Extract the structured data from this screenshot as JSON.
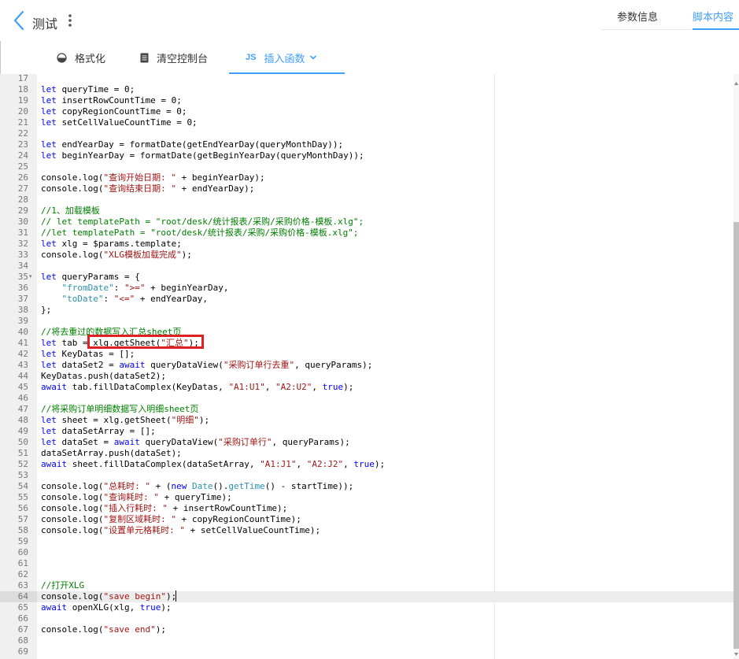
{
  "header": {
    "title": "测试",
    "right_tabs": [
      {
        "label": "参数信息"
      },
      {
        "label": "脚本内容"
      }
    ]
  },
  "toolbar": {
    "format_label": "格式化",
    "clear_console_label": "清空控制台",
    "js_badge": "JS",
    "insert_function_label": "插入函数"
  },
  "editor": {
    "active_line": 64,
    "lines": [
      {
        "n": 17,
        "code": ""
      },
      {
        "n": 18,
        "code": "let queryTime = 0;"
      },
      {
        "n": 19,
        "code": "let insertRowCountTime = 0;"
      },
      {
        "n": 20,
        "code": "let copyRegionCountTime = 0;"
      },
      {
        "n": 21,
        "code": "let setCellValueCountTime = 0;"
      },
      {
        "n": 22,
        "code": ""
      },
      {
        "n": 23,
        "code": "let endYearDay = formatDate(getEndYearDay(queryMonthDay));"
      },
      {
        "n": 24,
        "code": "let beginYearDay = formatDate(getBeginYearDay(queryMonthDay));"
      },
      {
        "n": 25,
        "code": ""
      },
      {
        "n": 26,
        "code": "console.log(\"查询开始日期: \" + beginYearDay);"
      },
      {
        "n": 27,
        "code": "console.log(\"查询结束日期: \" + endYearDay);"
      },
      {
        "n": 28,
        "code": ""
      },
      {
        "n": 29,
        "code": "//1、加载模板"
      },
      {
        "n": 30,
        "code": "// let templatePath = \"root/desk/统计报表/采购/采购价格-模板.xlg\";"
      },
      {
        "n": 31,
        "code": "//let templatePath = \"root/desk/统计报表/采购/采购价格-模板.xlg\";"
      },
      {
        "n": 32,
        "code": "let xlg = $params.template;"
      },
      {
        "n": 33,
        "code": "console.log(\"XLG模板加载完成\");"
      },
      {
        "n": 34,
        "code": ""
      },
      {
        "n": 35,
        "code": "let queryParams = {",
        "fold": true
      },
      {
        "n": 36,
        "code": "    \"fromDate\": \">=\" + beginYearDay,"
      },
      {
        "n": 37,
        "code": "    \"toDate\": \"<=\" + endYearDay,"
      },
      {
        "n": 38,
        "code": "};"
      },
      {
        "n": 39,
        "code": ""
      },
      {
        "n": 40,
        "code": "//将去重过的数据写入汇总sheet页"
      },
      {
        "n": 41,
        "code": "let tab = xlg.getSheet(\"汇总\");"
      },
      {
        "n": 42,
        "code": "let KeyDatas = [];"
      },
      {
        "n": 43,
        "code": "let dataSet2 = await queryDataView(\"采购订单行去重\", queryParams);"
      },
      {
        "n": 44,
        "code": "KeyDatas.push(dataSet2);"
      },
      {
        "n": 45,
        "code": "await tab.fillDataComplex(KeyDatas, \"A1:U1\", \"A2:U2\", true);"
      },
      {
        "n": 46,
        "code": ""
      },
      {
        "n": 47,
        "code": "//将采购订单明细数据写入明细sheet页"
      },
      {
        "n": 48,
        "code": "let sheet = xlg.getSheet(\"明细\");"
      },
      {
        "n": 49,
        "code": "let dataSetArray = [];"
      },
      {
        "n": 50,
        "code": "let dataSet = await queryDataView(\"采购订单行\", queryParams);"
      },
      {
        "n": 51,
        "code": "dataSetArray.push(dataSet);"
      },
      {
        "n": 52,
        "code": "await sheet.fillDataComplex(dataSetArray, \"A1:J1\", \"A2:J2\", true);"
      },
      {
        "n": 53,
        "code": ""
      },
      {
        "n": 54,
        "code": "console.log(\"总耗时: \" + (new Date().getTime() - startTime));"
      },
      {
        "n": 55,
        "code": "console.log(\"查询耗时: \" + queryTime);"
      },
      {
        "n": 56,
        "code": "console.log(\"插入行耗时: \" + insertRowCountTime);"
      },
      {
        "n": 57,
        "code": "console.log(\"复制区域耗时: \" + copyRegionCountTime);"
      },
      {
        "n": 58,
        "code": "console.log(\"设置单元格耗时: \" + setCellValueCountTime);"
      },
      {
        "n": 59,
        "code": ""
      },
      {
        "n": 60,
        "code": ""
      },
      {
        "n": 61,
        "code": ""
      },
      {
        "n": 62,
        "code": ""
      },
      {
        "n": 63,
        "code": "//打开XLG"
      },
      {
        "n": 64,
        "code": "console.log(\"save begin\");"
      },
      {
        "n": 65,
        "code": "await openXLG(xlg, true);"
      },
      {
        "n": 66,
        "code": ""
      },
      {
        "n": 67,
        "code": "console.log(\"save end\");"
      },
      {
        "n": 68,
        "code": ""
      },
      {
        "n": 69,
        "code": ""
      }
    ]
  },
  "colors": {
    "accent": "#409eff",
    "highlight_box": "#e02020",
    "keyword": "#0000ff",
    "string": "#a31515",
    "comment": "#008000"
  },
  "icons": {
    "back": "chevron-left-icon",
    "more": "vertical-dots-icon",
    "format": "palette-icon",
    "clear_console": "document-icon",
    "insert_function": "chevron-down-icon"
  }
}
